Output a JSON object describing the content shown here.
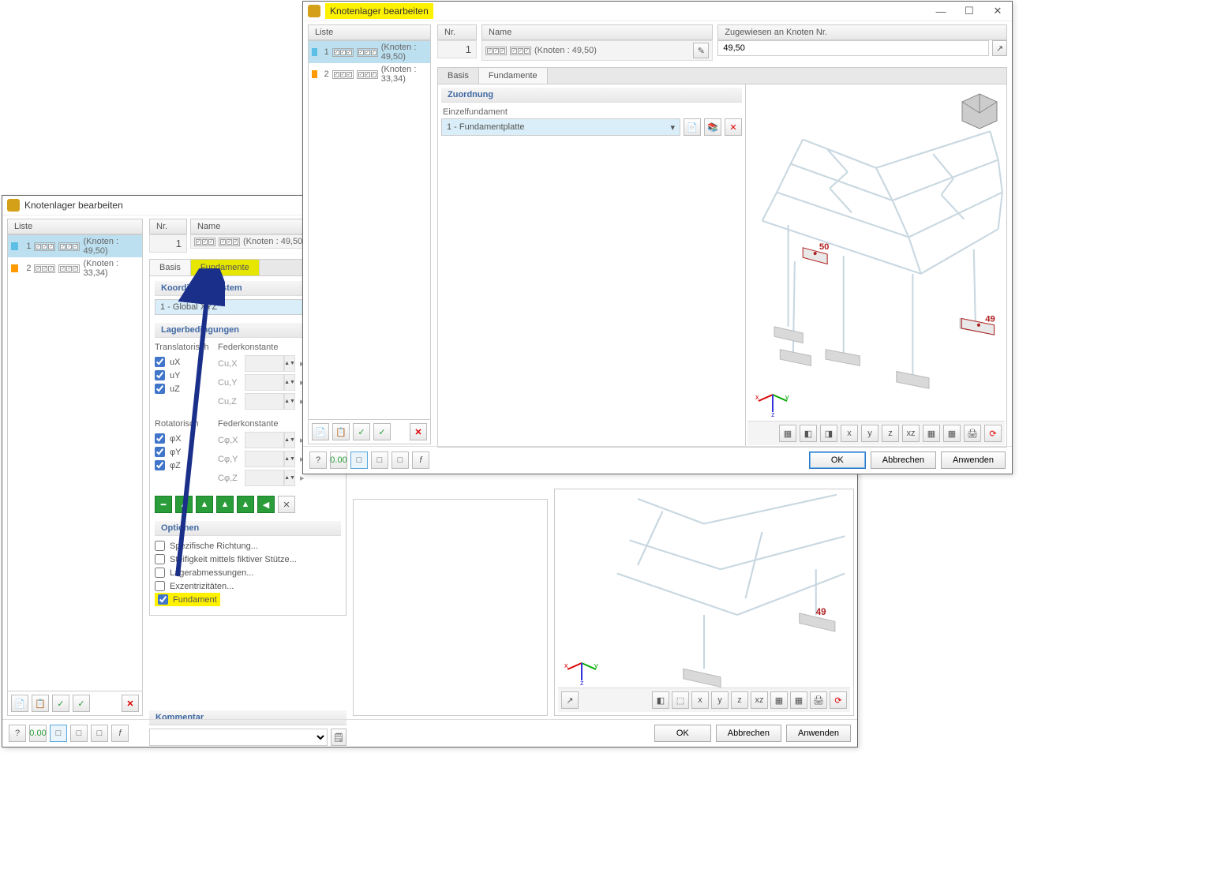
{
  "back_window": {
    "title": "Knotenlager bearbeiten",
    "list": {
      "header": "Liste",
      "rows": [
        {
          "idx": "1",
          "color": "blue",
          "note": "(Knoten : 49,50)"
        },
        {
          "idx": "2",
          "color": "orange",
          "note": "(Knoten : 33,34)"
        }
      ]
    },
    "nr": {
      "header": "Nr.",
      "value": "1"
    },
    "name": {
      "header": "Name",
      "value": "(Knoten : 49,50)"
    },
    "tabs": {
      "basis": "Basis",
      "fundamente": "Fundamente"
    },
    "coord": {
      "header": "Koordinatensystem",
      "value": "1 - Global XYZ"
    },
    "support": {
      "header": "Lagerbedingungen",
      "translat": "Translatorisch",
      "spring": "Federkonstante",
      "ux": "uX",
      "uy": "uY",
      "uz": "uZ",
      "cux": "Cu,X",
      "cuy": "Cu,Y",
      "cuz": "Cu,Z",
      "rotat": "Rotatorisch",
      "px": "φX",
      "py": "φY",
      "pz": "φZ",
      "cpx": "Cφ,X",
      "cpy": "Cφ,Y",
      "cpz": "Cφ,Z"
    },
    "options": {
      "header": "Optionen",
      "spec_dir": "Spezifische Richtung...",
      "stiffness": "Steifigkeit mittels fiktiver Stütze...",
      "dims": "Lagerabmessungen...",
      "ecc": "Exzentrizitäten...",
      "fundament": "Fundament"
    },
    "comment": {
      "header": "Kommentar"
    },
    "buttons": {
      "ok": "OK",
      "cancel": "Abbrechen",
      "apply": "Anwenden"
    },
    "viz": {
      "labels": {
        "n49": "49"
      }
    }
  },
  "front_window": {
    "title": "Knotenlager bearbeiten",
    "list": {
      "header": "Liste",
      "rows": [
        {
          "idx": "1",
          "color": "blue",
          "note": "(Knoten : 49,50)"
        },
        {
          "idx": "2",
          "color": "orange",
          "note": "(Knoten : 33,34)"
        }
      ]
    },
    "nr": {
      "header": "Nr.",
      "value": "1"
    },
    "name": {
      "header": "Name",
      "value": "(Knoten : 49,50)"
    },
    "assign": {
      "header": "Zugewiesen an Knoten Nr.",
      "value": "49,50"
    },
    "tabs": {
      "basis": "Basis",
      "fundamente": "Fundamente"
    },
    "assignment": {
      "header": "Zuordnung",
      "sub": "Einzelfundament",
      "value": "1 - Fundamentplatte"
    },
    "buttons": {
      "ok": "OK",
      "cancel": "Abbrechen",
      "apply": "Anwenden"
    },
    "viz": {
      "labels": {
        "n49": "49",
        "n50": "50"
      }
    }
  }
}
